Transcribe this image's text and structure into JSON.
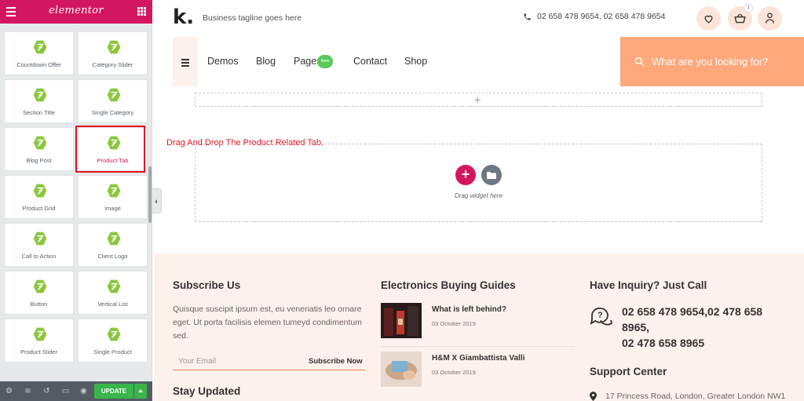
{
  "editor": {
    "brand": "elementor",
    "widgets": [
      {
        "label": "Countdown Offer"
      },
      {
        "label": "Category Slider"
      },
      {
        "label": "Section Title"
      },
      {
        "label": "Single Category"
      },
      {
        "label": "Blog Post"
      },
      {
        "label": "Product Tab"
      },
      {
        "label": "Product Grid"
      },
      {
        "label": "Image"
      },
      {
        "label": "Call to Action"
      },
      {
        "label": "Client Logo"
      },
      {
        "label": "Button"
      },
      {
        "label": "Vertical List"
      },
      {
        "label": "Product Slider"
      },
      {
        "label": "Single Product"
      }
    ],
    "highlighted_widget": "Product Tab",
    "update_label": "UPDATE",
    "accent_color": "#d3175f",
    "widget_icon_color": "#8cc63f"
  },
  "site": {
    "logo": "k.",
    "tagline": "Business tagline goes here",
    "phone": "02 658 478 9654, 02 658 478 9654",
    "cart_count": "1",
    "nav": {
      "items": [
        "Demos",
        "Blog",
        "Pages",
        "Contact",
        "Shop"
      ],
      "new_badge": "New"
    },
    "search_placeholder": "What are you looking for?",
    "instruction": "Drag And Drop The Product Related Tab.",
    "dropzone_text": "Drag widget here",
    "footer": {
      "subscribe": {
        "title": "Subscribe Us",
        "text_line1": "Quisque suscipit ipsum est, eu venenatis leo ornare",
        "text_line2": "eget. Ut porta facilisis elemen tumeyd condimentum",
        "text_line3": "sed.",
        "email_placeholder": "Your Email",
        "button": "Subscribe Now"
      },
      "stay_updated": "Stay Updated",
      "guides": {
        "title": "Electronics Buying Guides",
        "posts": [
          {
            "title": "What is left behind?",
            "date": "03 October 2019"
          },
          {
            "title": "H&M X Giambattista Valli",
            "date": "03 October 2019"
          }
        ]
      },
      "inquiry": {
        "title": "Have Inquiry? Just Call",
        "phone_line1": "02 658 478 9654,02 478 658",
        "phone_line2": "8965,",
        "phone_line3": "02 478 658 8965"
      },
      "support": {
        "title": "Support Center",
        "address": "17 Princess Road, London, Greater London NW1"
      }
    }
  }
}
